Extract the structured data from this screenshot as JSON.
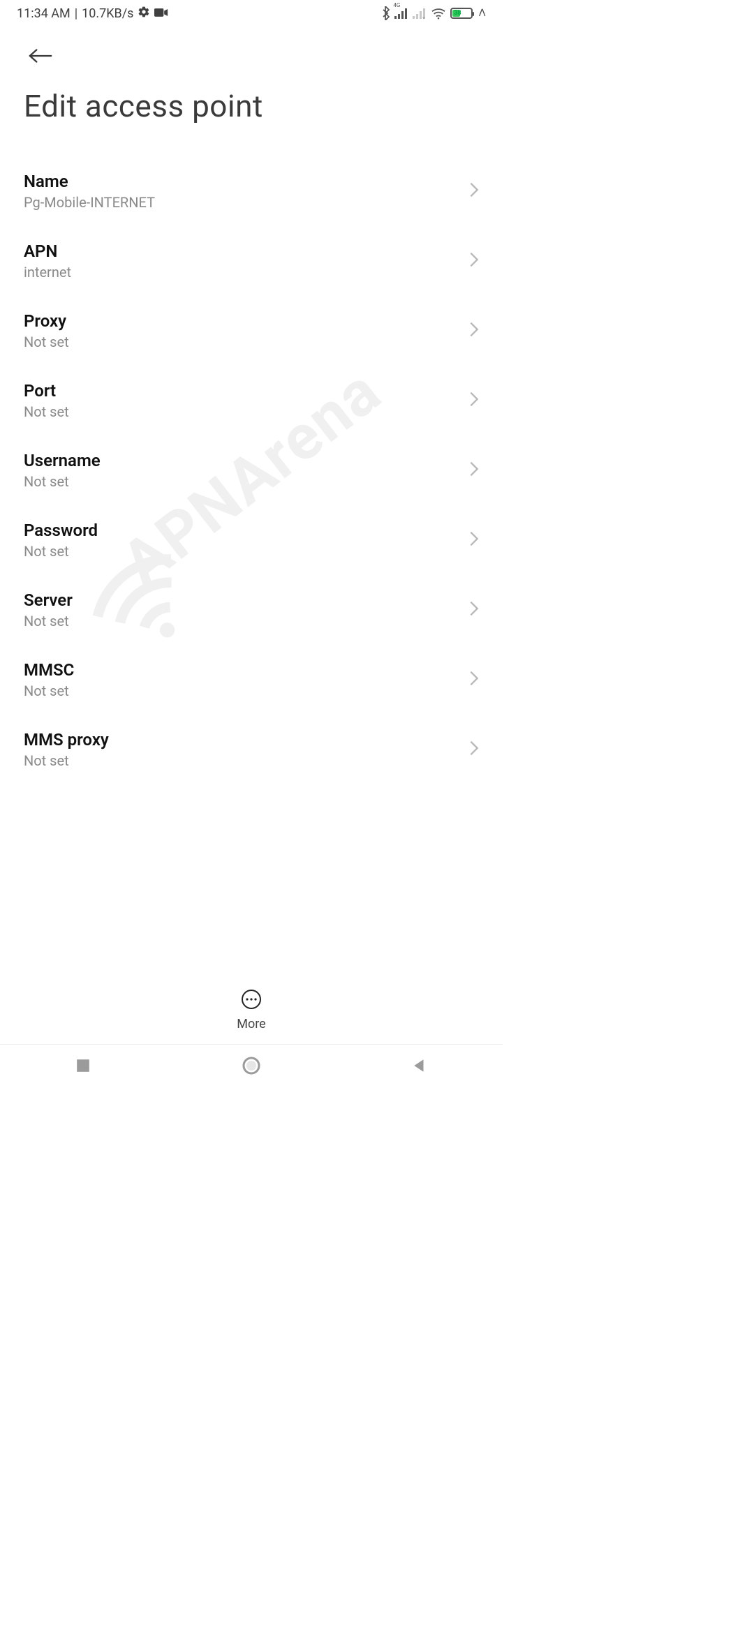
{
  "status": {
    "time": "11:34 AM",
    "net_speed": "10.7KB/s",
    "battery_pct": 38,
    "network_type": "4G"
  },
  "header": {
    "title": "Edit access point"
  },
  "watermark": "APNArena",
  "rows": {
    "name": {
      "label": "Name",
      "value": "Pg-Mobile-INTERNET"
    },
    "apn": {
      "label": "APN",
      "value": "internet"
    },
    "proxy": {
      "label": "Proxy",
      "value": "Not set"
    },
    "port": {
      "label": "Port",
      "value": "Not set"
    },
    "username": {
      "label": "Username",
      "value": "Not set"
    },
    "password": {
      "label": "Password",
      "value": "Not set"
    },
    "server": {
      "label": "Server",
      "value": "Not set"
    },
    "mmsc": {
      "label": "MMSC",
      "value": "Not set"
    },
    "mms_proxy": {
      "label": "MMS proxy",
      "value": "Not set"
    }
  },
  "dock": {
    "more_label": "More"
  }
}
